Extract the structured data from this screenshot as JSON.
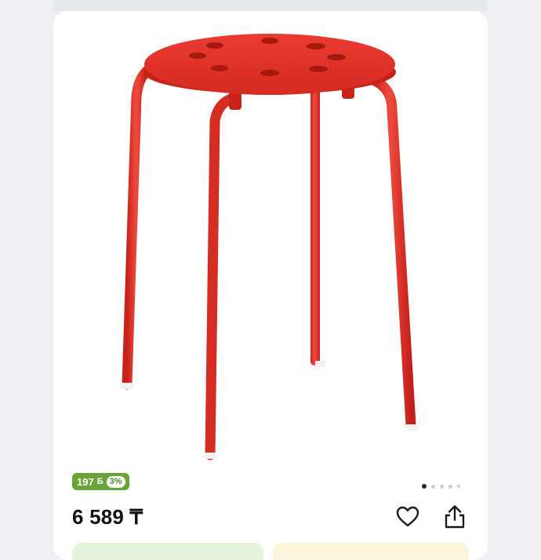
{
  "product": {
    "image_alt": "Red stool",
    "bonus_amount": "197",
    "bonus_icon": "Б",
    "bonus_percent": "3%",
    "price": "6 589 ₸"
  },
  "gallery": {
    "dots_total": 5,
    "active_index": 0
  },
  "icons": {
    "favorite": "heart-icon",
    "share": "share-icon"
  },
  "colors": {
    "stool_red": "#e8352b",
    "bonus_green": "#6aa33a"
  }
}
